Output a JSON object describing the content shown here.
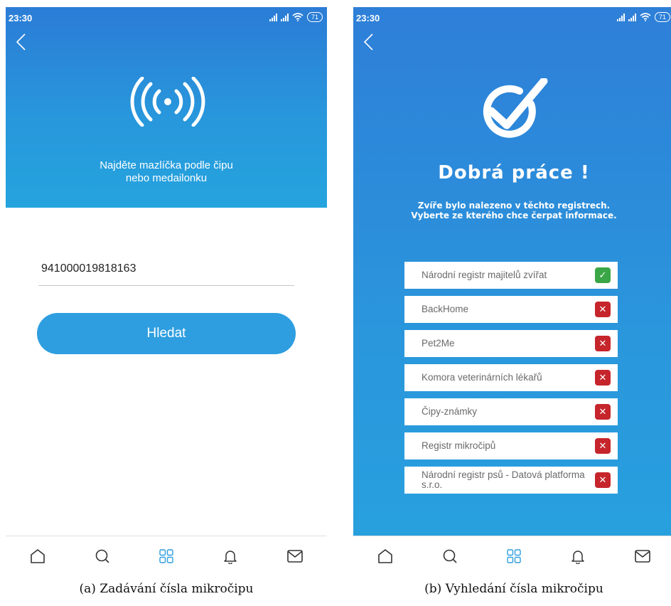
{
  "status_bar": {
    "time": "23:30",
    "battery": "71"
  },
  "screen_a": {
    "hero_text_line1": "Najděte mazlíčka podle čipu",
    "hero_text_line2": "nebo medailonku",
    "chip_input_value": "941000019818163",
    "search_button_label": "Hledat"
  },
  "screen_b": {
    "title": "Dobrá práce !",
    "message": "Zvíře bylo nalezeno v těchto registrech. Vyberte ze kterého chce čerpat informace.",
    "registries": [
      {
        "name": "Národní registr majitelů zvířat",
        "found": true,
        "status_symbol": "✓"
      },
      {
        "name": "BackHome",
        "found": false,
        "status_symbol": "✕"
      },
      {
        "name": "Pet2Me",
        "found": false,
        "status_symbol": "✕"
      },
      {
        "name": "Komora veterinárních lékařů",
        "found": false,
        "status_symbol": "✕"
      },
      {
        "name": "Čipy-známky",
        "found": false,
        "status_symbol": "✕"
      },
      {
        "name": "Registr mikročipů",
        "found": false,
        "status_symbol": "✕"
      },
      {
        "name": "Národní registr psů - Datová platforma s.r.o.",
        "found": false,
        "status_symbol": "✕"
      }
    ]
  },
  "bottom_nav": {
    "items": [
      "home-icon",
      "search-icon",
      "grid-icon",
      "bell-icon",
      "mail-icon"
    ],
    "active_color": "#2e9ee0",
    "inactive_color": "#333333"
  },
  "captions": {
    "a": "(a) Zadávání čísla mikročipu",
    "b": "(b) Vyhledání čísla mikročipu"
  },
  "colors": {
    "primary_blue": "#2e9ee0",
    "found_green": "#3aa645",
    "not_found_red": "#c6252c"
  }
}
